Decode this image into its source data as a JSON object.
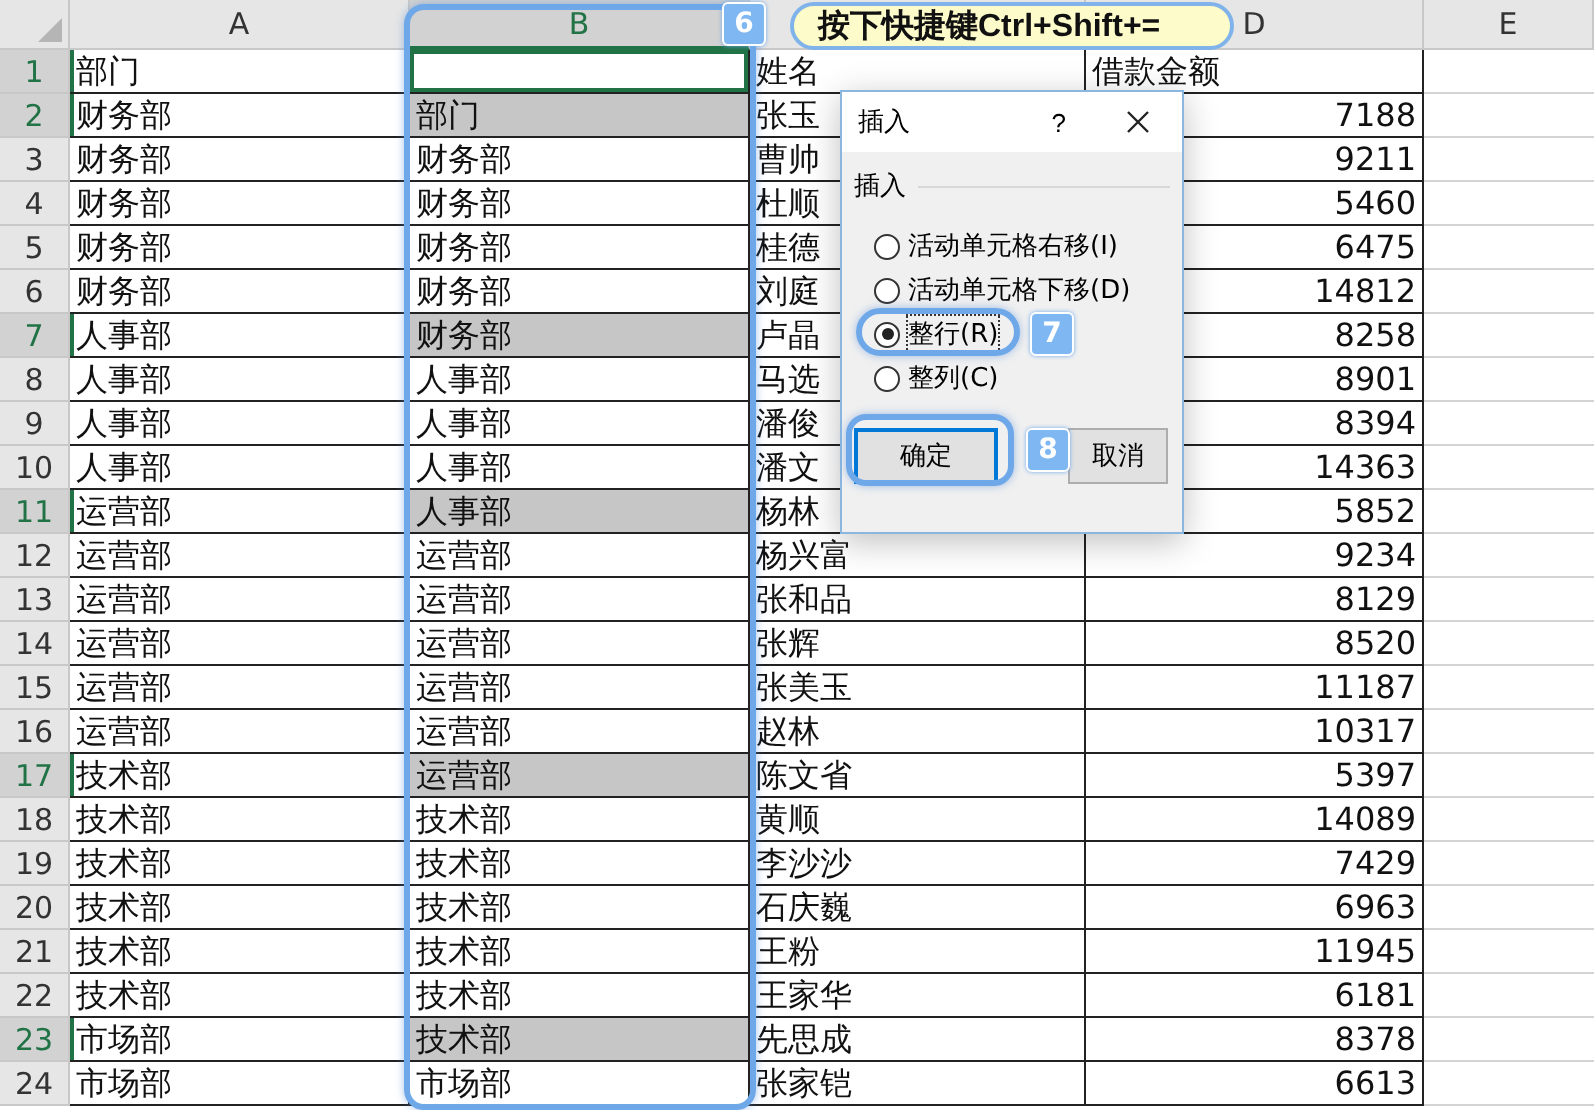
{
  "columns": [
    {
      "label": "A",
      "selected": false
    },
    {
      "label": "B",
      "selected": true
    },
    {
      "selected": false
    },
    {
      "label": "D",
      "selected": false
    },
    {
      "label": "E",
      "selected": false
    }
  ],
  "rows": [
    {
      "number": "1",
      "selected": true,
      "active": true,
      "a": "部门",
      "c": "姓名",
      "d": "借款金额"
    },
    {
      "number": "2",
      "selected": true,
      "a": "财务部",
      "b": "部门",
      "c": "张玉",
      "d": "7188"
    },
    {
      "number": "3",
      "selected": false,
      "a": "财务部",
      "b": "财务部",
      "c": "曹帅",
      "d": "9211"
    },
    {
      "number": "4",
      "selected": false,
      "a": "财务部",
      "b": "财务部",
      "c": "杜顺",
      "d": "5460"
    },
    {
      "number": "5",
      "selected": false,
      "a": "财务部",
      "b": "财务部",
      "c": "桂德",
      "d": "6475"
    },
    {
      "number": "6",
      "selected": false,
      "a": "财务部",
      "b": "财务部",
      "c": "刘庭",
      "d": "14812"
    },
    {
      "number": "7",
      "selected": true,
      "a": "人事部",
      "b": "财务部",
      "c": "卢晶",
      "d": "8258"
    },
    {
      "number": "8",
      "selected": false,
      "a": "人事部",
      "b": "人事部",
      "c": "马选",
      "d": "8901"
    },
    {
      "number": "9",
      "selected": false,
      "a": "人事部",
      "b": "人事部",
      "c": "潘俊",
      "d": "8394"
    },
    {
      "number": "10",
      "selected": false,
      "a": "人事部",
      "b": "人事部",
      "c": "潘文",
      "d": "14363"
    },
    {
      "number": "11",
      "selected": true,
      "a": "运营部",
      "b": "人事部",
      "c": "杨林",
      "d": "5852"
    },
    {
      "number": "12",
      "selected": false,
      "a": "运营部",
      "b": "运营部",
      "c": "杨兴富",
      "d": "9234"
    },
    {
      "number": "13",
      "selected": false,
      "a": "运营部",
      "b": "运营部",
      "c": "张和品",
      "d": "8129"
    },
    {
      "number": "14",
      "selected": false,
      "a": "运营部",
      "b": "运营部",
      "c": "张辉",
      "d": "8520"
    },
    {
      "number": "15",
      "selected": false,
      "a": "运营部",
      "b": "运营部",
      "c": "张美玉",
      "d": "11187"
    },
    {
      "number": "16",
      "selected": false,
      "a": "运营部",
      "b": "运营部",
      "c": "赵林",
      "d": "10317"
    },
    {
      "number": "17",
      "selected": true,
      "a": "技术部",
      "b": "运营部",
      "c": "陈文省",
      "d": "5397"
    },
    {
      "number": "18",
      "selected": false,
      "a": "技术部",
      "b": "技术部",
      "c": "黄顺",
      "d": "14089"
    },
    {
      "number": "19",
      "selected": false,
      "a": "技术部",
      "b": "技术部",
      "c": "李沙沙",
      "d": "7429"
    },
    {
      "number": "20",
      "selected": false,
      "a": "技术部",
      "b": "技术部",
      "c": "石庆巍",
      "d": "6963"
    },
    {
      "number": "21",
      "selected": false,
      "a": "技术部",
      "b": "技术部",
      "c": "王粉",
      "d": "11945"
    },
    {
      "number": "22",
      "selected": false,
      "a": "技术部",
      "b": "技术部",
      "c": "王家华",
      "d": "6181"
    },
    {
      "number": "23",
      "selected": true,
      "a": "市场部",
      "b": "技术部",
      "c": "先思成",
      "d": "8378"
    },
    {
      "number": "24",
      "selected": false,
      "a": "市场部",
      "b": "市场部",
      "c": "张家铠",
      "d": "6613"
    }
  ],
  "callout": {
    "text": "按下快捷键Ctrl+Shift+="
  },
  "badges": [
    "6",
    "7",
    "8"
  ],
  "dialog": {
    "title": "插入",
    "help": "?",
    "group_label": "插入",
    "options": [
      {
        "label": "活动单元格右移(I)",
        "selected": false
      },
      {
        "label": "活动单元格下移(D)",
        "selected": false
      },
      {
        "label": "整行(R)",
        "selected": true
      },
      {
        "label": "整列(C)",
        "selected": false
      }
    ],
    "ok": "确定",
    "cancel": "取消"
  }
}
